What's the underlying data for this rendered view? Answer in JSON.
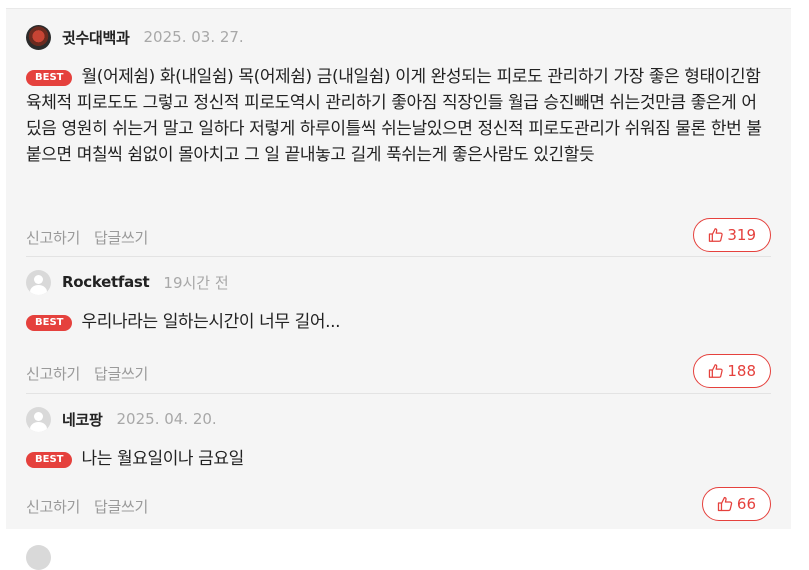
{
  "comments": [
    {
      "nickname": "귓수대백과",
      "date": "2025. 03. 27.",
      "badge": "BEST",
      "text": "월(어제쉼) 화(내일쉼) 목(어제쉼) 금(내일쉼) 이게 완성되는 피로도 관리하기 가장 좋은 형태이긴함 육체적 피로도도 그렇고 정신적 피로도역시 관리하기 좋아짐 직장인들 월급 승진빼면 쉬는것만큼 좋은게 어딨음 영원히 쉬는거 말고 일하다 저렇게 하루이틀씩 쉬는날있으면 정신적 피로도관리가 쉬워짐 물론 한번 불붙으면 며칠씩 쉼없이 몰아치고 그 일 끝내놓고 길게 푹쉬는게 좋은사람도 있긴할듯",
      "report_label": "신고하기",
      "reply_label": "답글쓰기",
      "likes": "319",
      "avatar": "photo"
    },
    {
      "nickname": "Rocketfast",
      "date": "19시간 전",
      "badge": "BEST",
      "text": "우리나라는 일하는시간이 너무 길어...",
      "report_label": "신고하기",
      "reply_label": "답글쓰기",
      "likes": "188",
      "avatar": "default"
    },
    {
      "nickname": "네코팡",
      "date": "2025. 04. 20.",
      "badge": "BEST",
      "text": "나는 월요일이나 금요일",
      "report_label": "신고하기",
      "reply_label": "답글쓰기",
      "likes": "66",
      "avatar": "default"
    }
  ],
  "colors": {
    "accent": "#e5413d",
    "muted": "#9a9a9a",
    "background": "#f5f5f5"
  },
  "icons": {
    "like": "thumbs-up-icon",
    "avatar_default": "default-avatar-icon"
  }
}
